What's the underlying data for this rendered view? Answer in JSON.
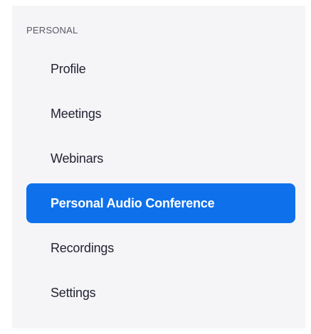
{
  "sidebar": {
    "section_title": "PERSONAL",
    "active_index": 3,
    "items": [
      {
        "label": "Profile"
      },
      {
        "label": "Meetings"
      },
      {
        "label": "Webinars"
      },
      {
        "label": "Personal Audio Conference"
      },
      {
        "label": "Recordings"
      },
      {
        "label": "Settings"
      }
    ]
  },
  "colors": {
    "sidebar_bg": "#f5f5f8",
    "active_bg": "#0e71eb",
    "active_text": "#ffffff",
    "item_text": "#232333",
    "section_text": "#595966"
  }
}
